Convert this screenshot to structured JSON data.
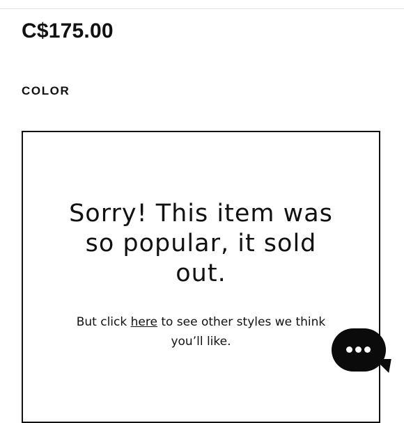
{
  "product": {
    "price": "C$175.00",
    "color_label": "COLOR"
  },
  "sold_out": {
    "heading_lines": [
      "Sorry! This item was",
      "so popular, it sold",
      "out."
    ],
    "message_prefix": "But click ",
    "link_text": "here",
    "message_suffix_line1": " to see other styles we think",
    "message_line2": "you’ll like."
  },
  "chat": {
    "icon": "chat-bubble-ellipsis-icon"
  }
}
